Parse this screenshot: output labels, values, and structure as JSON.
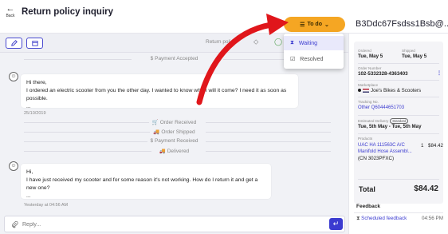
{
  "header": {
    "back_arrow": "←",
    "back_label": "Back",
    "title": "Return policy inquiry",
    "status_button": {
      "label": "To do",
      "icon": "list-icon",
      "chevron": "⌄",
      "color": "#f5a623"
    },
    "order_title": "B3Ddc67Fsdss1Bsb@..."
  },
  "toolbar": {
    "edit_icon": "pencil-icon",
    "schedule_icon": "calendar-icon",
    "tag_label": "Return policy",
    "tag_icon": "tag-icon",
    "check_icon": "check-circle-icon"
  },
  "status_menu": {
    "items": [
      {
        "label": "Waiting",
        "icon": "hourglass-icon",
        "active": true
      },
      {
        "label": "Resolved",
        "icon": "checkbox-icon",
        "active": false
      }
    ]
  },
  "conversation": {
    "events": [
      {
        "icon": "$",
        "label": "Payment Accepted"
      },
      {
        "icon": "🛒",
        "label": "Order Received"
      },
      {
        "icon": "🚚",
        "label": "Order Shipped"
      },
      {
        "icon": "$",
        "label": "Payment Received"
      },
      {
        "icon": "🚚",
        "label": "Delivered"
      }
    ],
    "messages": [
      {
        "greeting": "Hi there,",
        "body": "I ordered an electric scooter from you the other day. I wanted to know when will it come? I need it as soon as possible.",
        "ellipsis": "...",
        "timestamp": "25/10/2019"
      },
      {
        "greeting": "Hi,",
        "body": "I have just received my scooter and for some reason it's not working. How do I return it and get a new one?",
        "ellipsis": "...",
        "timestamp": "Yesterday at 04:56 AM"
      }
    ]
  },
  "reply": {
    "placeholder": "Reply...",
    "attach_icon": "paperclip-icon",
    "send_icon": "send-icon"
  },
  "order": {
    "ordered_label": "Ordered",
    "ordered_value": "Tue, May 5",
    "shipped_label": "Shipped",
    "shipped_value": "Tue, May 5",
    "number_label": "Order Number",
    "number_value": "102-5332328-4363403",
    "marketplace_label": "Marketplace",
    "marketplace_value": "Joe's Bikes & Scooters",
    "tracking_label": "Tracking No.",
    "tracking_value": "Other Q60444651703",
    "delivery_label": "Estimated Delivery",
    "delivery_badge": "Standard",
    "delivery_value": "Tue, 5th May - Tue, 5th May",
    "products_label": "Products",
    "product_name_1": "UAC HA 111563C A/C",
    "product_name_2": "Manifold Hose Assembl...",
    "product_sku": "(CN 3023PFXC)",
    "product_qty": "1",
    "product_price": "$84.42",
    "total_label": "Total",
    "total_value": "$84.42"
  },
  "feedback": {
    "heading": "Feedback",
    "item_label": "Scheduled feedback",
    "item_time": "04:56 PM"
  },
  "colors": {
    "accent": "#3b3bd0",
    "status": "#f5a623",
    "annotation_arrow": "#e0161b"
  }
}
